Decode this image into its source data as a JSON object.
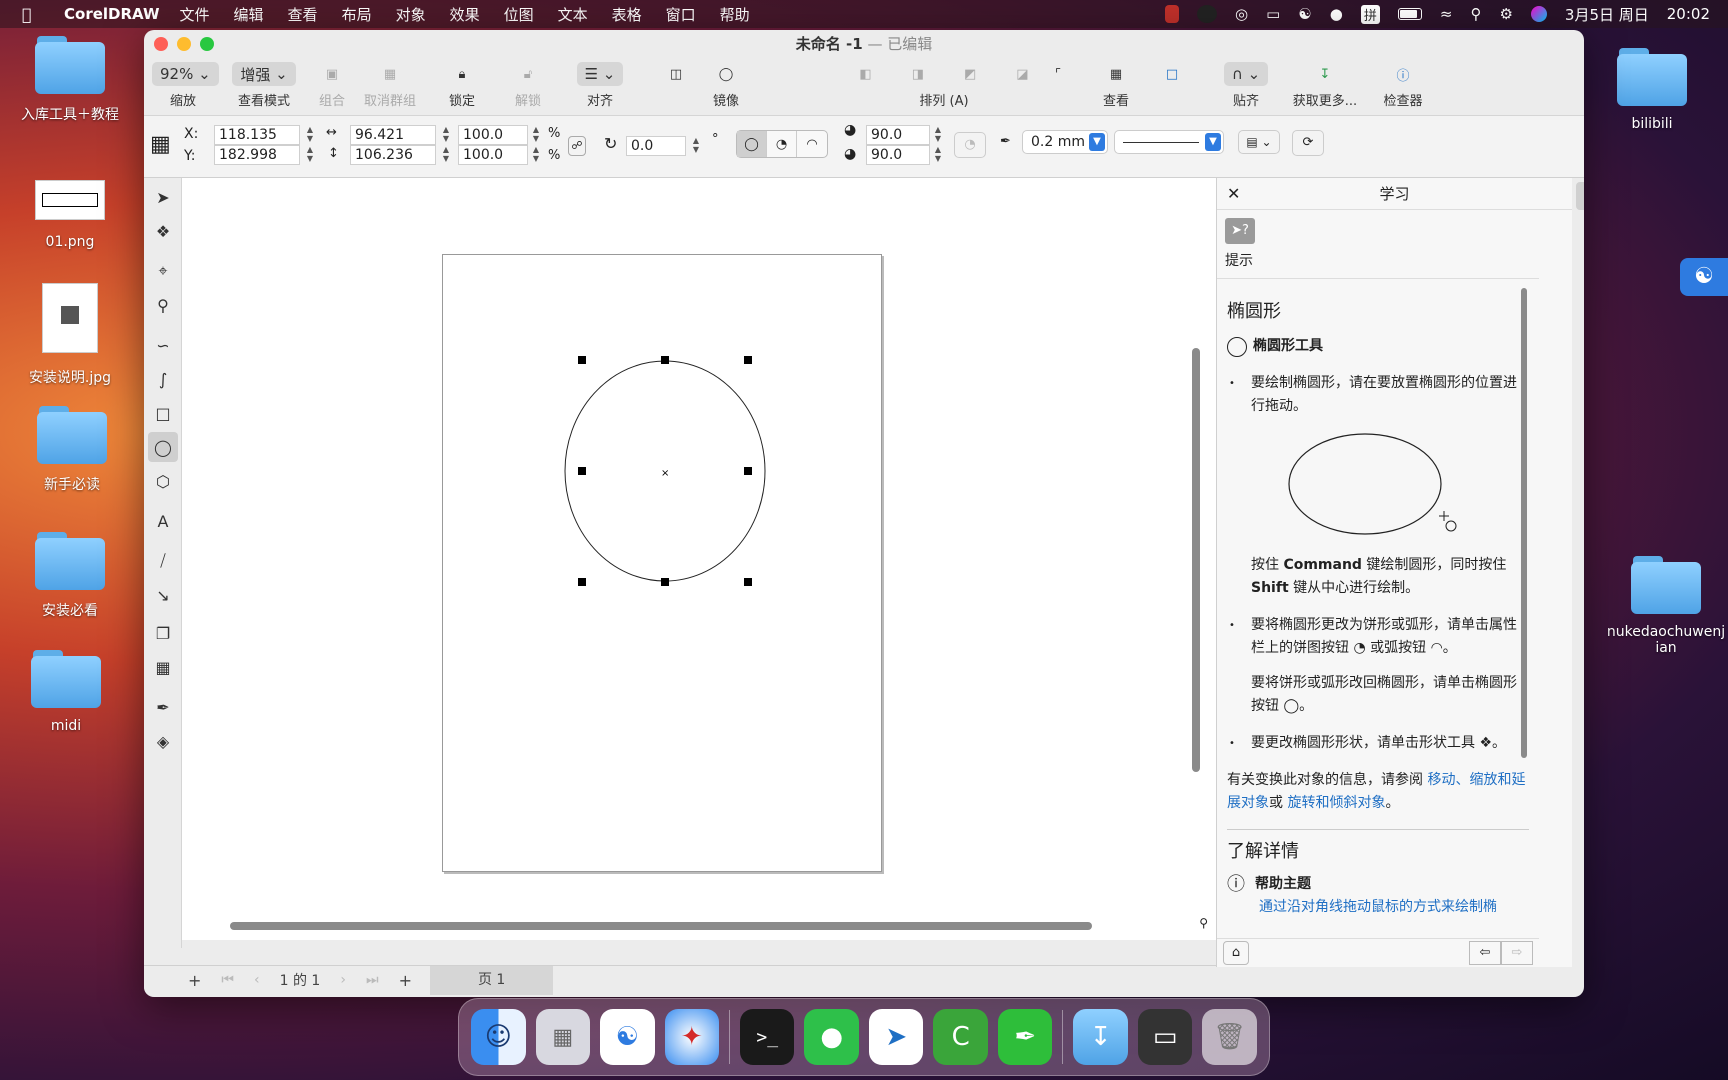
{
  "menubar": {
    "app": "CorelDRAW",
    "items": [
      "文件",
      "编辑",
      "查看",
      "布局",
      "对象",
      "效果",
      "位图",
      "文本",
      "表格",
      "窗口",
      "帮助"
    ],
    "date": "3月5日 周日",
    "time": "20:02",
    "ime": "拼"
  },
  "desktop": {
    "left": [
      {
        "label": "入库工具＋教程",
        "kind": "folder"
      },
      {
        "label": "01.png",
        "kind": "image"
      },
      {
        "label": "安装说明.jpg",
        "kind": "doc"
      },
      {
        "label": "新手必读",
        "kind": "folder"
      },
      {
        "label": "安装必看",
        "kind": "folder"
      },
      {
        "label": "midi",
        "kind": "folder"
      }
    ],
    "right": [
      {
        "label": "bilibili",
        "kind": "folder"
      },
      {
        "label": "nukedaochuwenjian",
        "kind": "folder"
      }
    ]
  },
  "window": {
    "title": "未命名 -1",
    "edited": "— 已编辑"
  },
  "toolbar": {
    "zoom": "92%",
    "zoom_label": "缩放",
    "view_mode": "增强",
    "view_mode_label": "查看模式",
    "group": "组合",
    "ungroup": "取消群组",
    "lock": "锁定",
    "unlock": "解锁",
    "align": "对齐",
    "mirror": "镜像",
    "arrange": "排列 (A)",
    "view": "查看",
    "snap": "贴齐",
    "get_more": "获取更多...",
    "inspector": "检查器"
  },
  "props": {
    "x_label": "X:",
    "y_label": "Y:",
    "x": "118.135",
    "y": "182.998",
    "width": "96.421",
    "height": "106.236",
    "scale_w": "100.0",
    "scale_h": "100.0",
    "pct": "%",
    "rotation": "0.0",
    "deg": "°",
    "start_angle": "90.0",
    "end_angle": "90.0",
    "outline_width": "0.2 mm"
  },
  "status": {
    "page_count": "1 的 1",
    "page_tab": "页 1"
  },
  "panel": {
    "title": "学习",
    "hint_label": "提示",
    "heading": "椭圆形",
    "tool_name": "椭圆形工具",
    "b1": "要绘制椭圆形，请在要放置椭圆形的位置进行拖动。",
    "note_pre": "按住 ",
    "note_cmd": "Command",
    "note_mid": " 键绘制圆形，同时按住 ",
    "note_shift": "Shift",
    "note_post": " 键从中心进行绘制。",
    "b2": "要将椭圆形更改为饼形或弧形，请单击属性栏上的饼图按钮",
    "b2_or": "或弧按钮",
    "b2_end": "。",
    "b2b": "要将饼形或弧形改回椭圆形，请单击椭圆形按钮",
    "b2b_end": "。",
    "b3": "要更改椭圆形形状，请单击形状工具",
    "b3_end": "。",
    "info_pre": "有关变换此对象的信息，请参阅 ",
    "link1": "移动、缩放和延展对象",
    "info_or": "或 ",
    "link2": "旋转和倾斜对象",
    "info_end": "。",
    "learn_more": "了解详情",
    "help_topic": "帮助主题",
    "help_link": "通过沿对角线拖动鼠标的方式来绘制椭"
  },
  "colors": {
    "accent": "#1f6fc4",
    "window_bg": "#ececec",
    "palette": [
      "#1a1a1a",
      "#333333",
      "#4d4d4d",
      "#666666",
      "#808080",
      "#999999",
      "#b3b3b3",
      "#cccccc",
      "#e6e6e6",
      "#ffffff",
      "#1a2a8c",
      "#2f8be0",
      "#2e9a4e",
      "#f2e832",
      "#d42a2a",
      "#c42a7a",
      "#a0307e",
      "#e87a2a",
      "#e8a0a8",
      "#7a6a5a",
      "#b8b0d8",
      "#9890c8",
      "#7a70b8",
      "#5a6ac0",
      "#6a5aa0",
      "#4a4a8a",
      "#3a3a6a",
      "#5a7aa8",
      "#3a7ac8",
      "#a8d0f0",
      "#8ab0c8",
      "#6a8aa0",
      "#4a6a80",
      "#3a5060",
      "#4a6060",
      "#4a7a6a",
      "#3a8a6a",
      "#5aa070"
    ]
  }
}
